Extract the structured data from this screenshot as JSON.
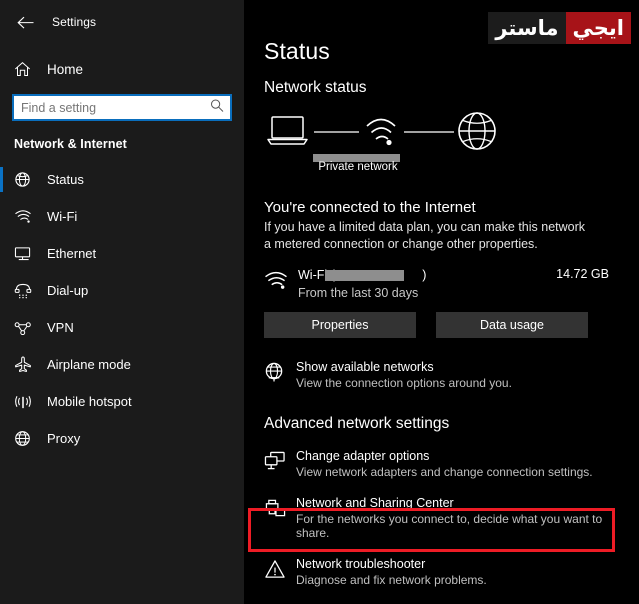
{
  "window": {
    "app_title": "Settings",
    "back_icon": "back-arrow-icon"
  },
  "sidebar": {
    "home": {
      "label": "Home",
      "icon": "home-icon"
    },
    "search": {
      "placeholder": "Find a setting",
      "value": "",
      "icon": "search-icon"
    },
    "group_title": "Network & Internet",
    "items": [
      {
        "label": "Status",
        "icon": "globe-status-icon",
        "active": true
      },
      {
        "label": "Wi-Fi",
        "icon": "wifi-icon",
        "active": false
      },
      {
        "label": "Ethernet",
        "icon": "ethernet-icon",
        "active": false
      },
      {
        "label": "Dial-up",
        "icon": "dialup-icon",
        "active": false
      },
      {
        "label": "VPN",
        "icon": "vpn-icon",
        "active": false
      },
      {
        "label": "Airplane mode",
        "icon": "airplane-icon",
        "active": false
      },
      {
        "label": "Mobile hotspot",
        "icon": "hotspot-icon",
        "active": false
      },
      {
        "label": "Proxy",
        "icon": "proxy-globe-icon",
        "active": false
      }
    ]
  },
  "main": {
    "page_title": "Status",
    "network_status_head": "Network status",
    "diagram": {
      "device_icon": "laptop-icon",
      "middle_icon": "wifi-signal-icon",
      "internet_icon": "globe-icon",
      "network_name_redacted": true,
      "network_type": "Private network"
    },
    "connected_title": "You're connected to the Internet",
    "connected_desc": "If you have a limited data plan, you can make this network a metered connection or change other properties.",
    "wifi": {
      "icon": "wifi-signal-icon",
      "name_prefix": "Wi-Fi (",
      "name_suffix": ")",
      "name_redacted": true,
      "period": "From the last 30 days",
      "usage": "14.72 GB"
    },
    "buttons": {
      "properties": "Properties",
      "data_usage": "Data usage"
    },
    "show_networks": {
      "icon": "globe-network-icon",
      "title": "Show available networks",
      "subtitle": "View the connection options around you."
    },
    "advanced_head": "Advanced network settings",
    "advanced_links": [
      {
        "icon": "adapter-monitor-icon",
        "title": "Change adapter options",
        "subtitle": "View network adapters and change connection settings.",
        "highlighted": false
      },
      {
        "icon": "sharing-center-icon",
        "title": "Network and Sharing Center",
        "subtitle": "For the networks you connect to, decide what you want to share.",
        "highlighted": true
      },
      {
        "icon": "warning-triangle-icon",
        "title": "Network troubleshooter",
        "subtitle": "Diagnose and fix network problems.",
        "highlighted": false
      }
    ]
  },
  "watermark": {
    "dark_text": "ماستر",
    "red_text": "ايجي",
    "red_color": "#a71318"
  }
}
